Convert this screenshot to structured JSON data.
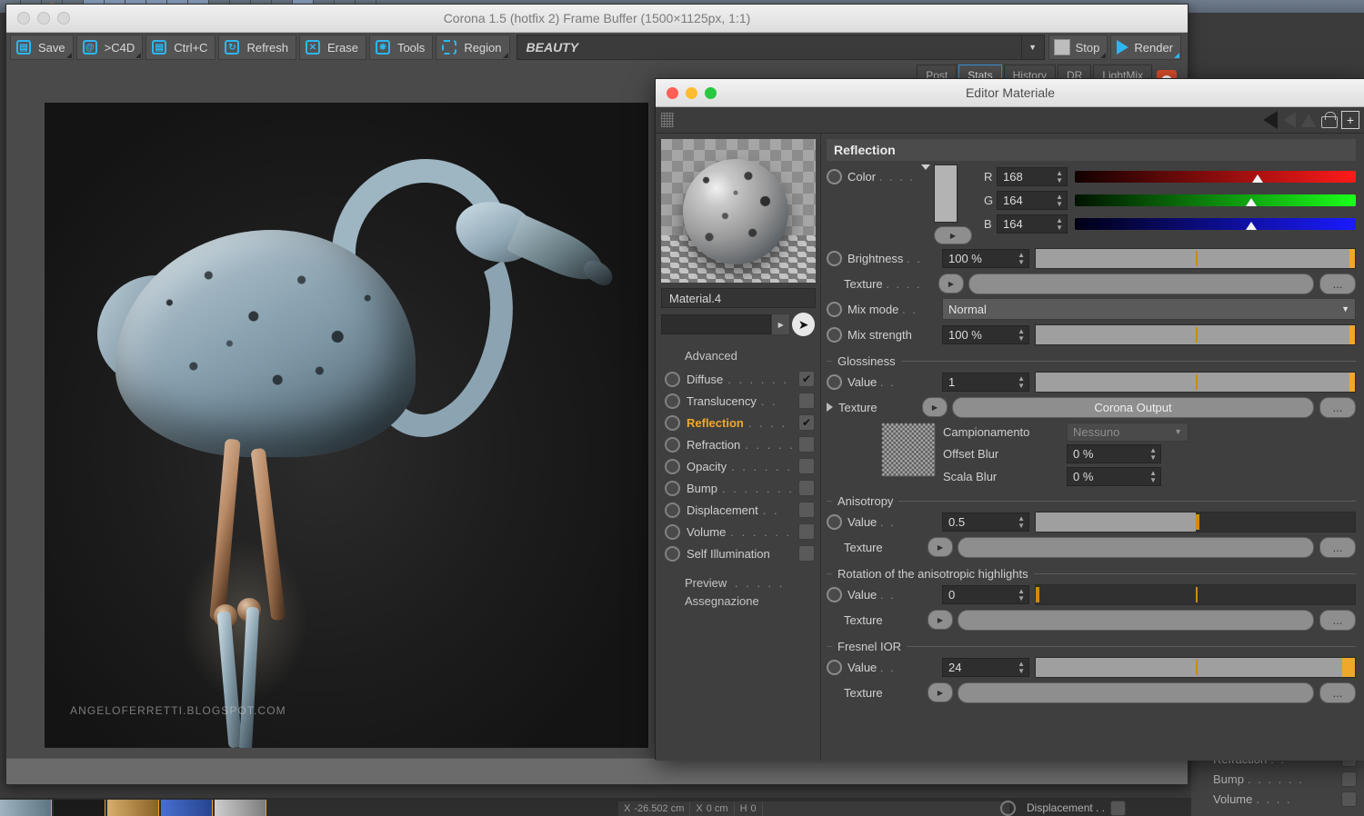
{
  "c4d": {
    "coord_bar": [
      {
        "axis": "X",
        "value": "-26.502 cm"
      },
      {
        "axis": "X",
        "value": "0 cm"
      },
      {
        "axis": "H",
        "value": "0"
      }
    ],
    "right_attr_rows": [
      {
        "label": "Refraction",
        "dots": ". ."
      },
      {
        "label": "Bump",
        "dots": ". . . . . ."
      },
      {
        "label": "Volume",
        "dots": ". . . ."
      }
    ],
    "displacement_label": "Displacement . ."
  },
  "frame_buffer": {
    "title": "Corona 1.5 (hotfix 2) Frame Buffer (1500×1125px, 1:1)",
    "toolbar": [
      {
        "label": "Save",
        "icon": "save-icon",
        "glyph": "▤"
      },
      {
        "label": ">C4D",
        "icon": "c4d-icon",
        "glyph": "@"
      },
      {
        "label": "Ctrl+C",
        "icon": "copy-icon",
        "glyph": "☰"
      },
      {
        "label": "Refresh",
        "icon": "refresh-icon",
        "glyph": "↻"
      },
      {
        "label": "Erase",
        "icon": "erase-icon",
        "glyph": "✕"
      },
      {
        "label": "Tools",
        "icon": "gear-icon",
        "glyph": "⚙"
      },
      {
        "label": "Region",
        "icon": "region-icon",
        "glyph": "⬚"
      }
    ],
    "pass_select": "BEAUTY",
    "stop_label": "Stop",
    "render_label": "Render",
    "tabs": [
      {
        "label": "Post",
        "selected": false
      },
      {
        "label": "Stats",
        "selected": true
      },
      {
        "label": "History",
        "selected": false
      },
      {
        "label": "DR",
        "selected": false
      },
      {
        "label": "LightMix",
        "selected": false
      }
    ],
    "watermark": "ANGELOFERRETTI.BLOGSPOT.COM"
  },
  "material_editor": {
    "title": "Editor Materiale",
    "material_name": "Material.4",
    "search_value": "",
    "channels_header": "Advanced",
    "channels": [
      {
        "label": "Diffuse",
        "dots": ". . . . . . . .",
        "checked": true,
        "active": false
      },
      {
        "label": "Translucency",
        "dots": ". .",
        "checked": false,
        "active": false
      },
      {
        "label": "Reflection",
        "dots": ". . . . .",
        "checked": true,
        "active": true
      },
      {
        "label": "Refraction",
        "dots": ". . . . .",
        "checked": false,
        "active": false
      },
      {
        "label": "Opacity",
        "dots": ". . . . . . .",
        "checked": false,
        "active": false
      },
      {
        "label": "Bump",
        "dots": ". . . . . . . .",
        "checked": false,
        "active": false
      },
      {
        "label": "Displacement",
        "dots": ". .",
        "checked": false,
        "active": false
      },
      {
        "label": "Volume",
        "dots": ". . . . . . .",
        "checked": false,
        "active": false
      },
      {
        "label": "Self Illumination",
        "dots": "",
        "checked": false,
        "active": false
      }
    ],
    "footer_items": [
      {
        "label": "Preview",
        "dots": ". . . . ."
      },
      {
        "label": "Assegnazione",
        "dots": ""
      }
    ],
    "section_title": "Reflection",
    "color": {
      "label": "Color",
      "dots": ". . . .",
      "swatch_hex": "#b3b3b3",
      "r_label": "R",
      "r_value": "168",
      "g_label": "G",
      "g_value": "164",
      "b_label": "B",
      "b_value": "164",
      "r_pct": 66,
      "g_pct": 64,
      "b_pct": 64
    },
    "brightness": {
      "label": "Brightness",
      "dots": ". .",
      "value": "100 %",
      "pct": 100
    },
    "color_texture": {
      "label": "Texture",
      "dots": ". . . .",
      "value": ""
    },
    "mix_mode": {
      "label": "Mix mode",
      "dots": ". .",
      "value": "Normal"
    },
    "mix_strength": {
      "label": "Mix strength",
      "dots": "",
      "value": "100 %",
      "pct": 100
    },
    "glossiness": {
      "group": "Glossiness",
      "value_label": "Value",
      "value_dots": ". .",
      "value": "1",
      "pct": 100,
      "texture_label": "Texture",
      "texture_value": "Corona Output",
      "sampling_label": "Campionamento",
      "sampling_value": "Nessuno",
      "offset_blur_label": "Offset Blur",
      "offset_blur_value": "0 %",
      "scala_blur_label": "Scala Blur",
      "scala_blur_value": "0 %"
    },
    "anisotropy": {
      "group": "Anisotropy",
      "value_label": "Value",
      "value_dots": ". .",
      "value": "0.5",
      "pct": 50,
      "texture_label": "Texture",
      "texture_value": ""
    },
    "rotation": {
      "group": "Rotation of the anisotropic highlights",
      "value_label": "Value",
      "value_dots": ". .",
      "value": "0",
      "pct": 0,
      "texture_label": "Texture",
      "texture_value": ""
    },
    "fresnel": {
      "group": "Fresnel IOR",
      "value_label": "Value",
      "value_dots": ". .",
      "value": "24",
      "pct": 100,
      "texture_label": "Texture",
      "texture_value": ""
    },
    "dots_button_label": "..."
  }
}
